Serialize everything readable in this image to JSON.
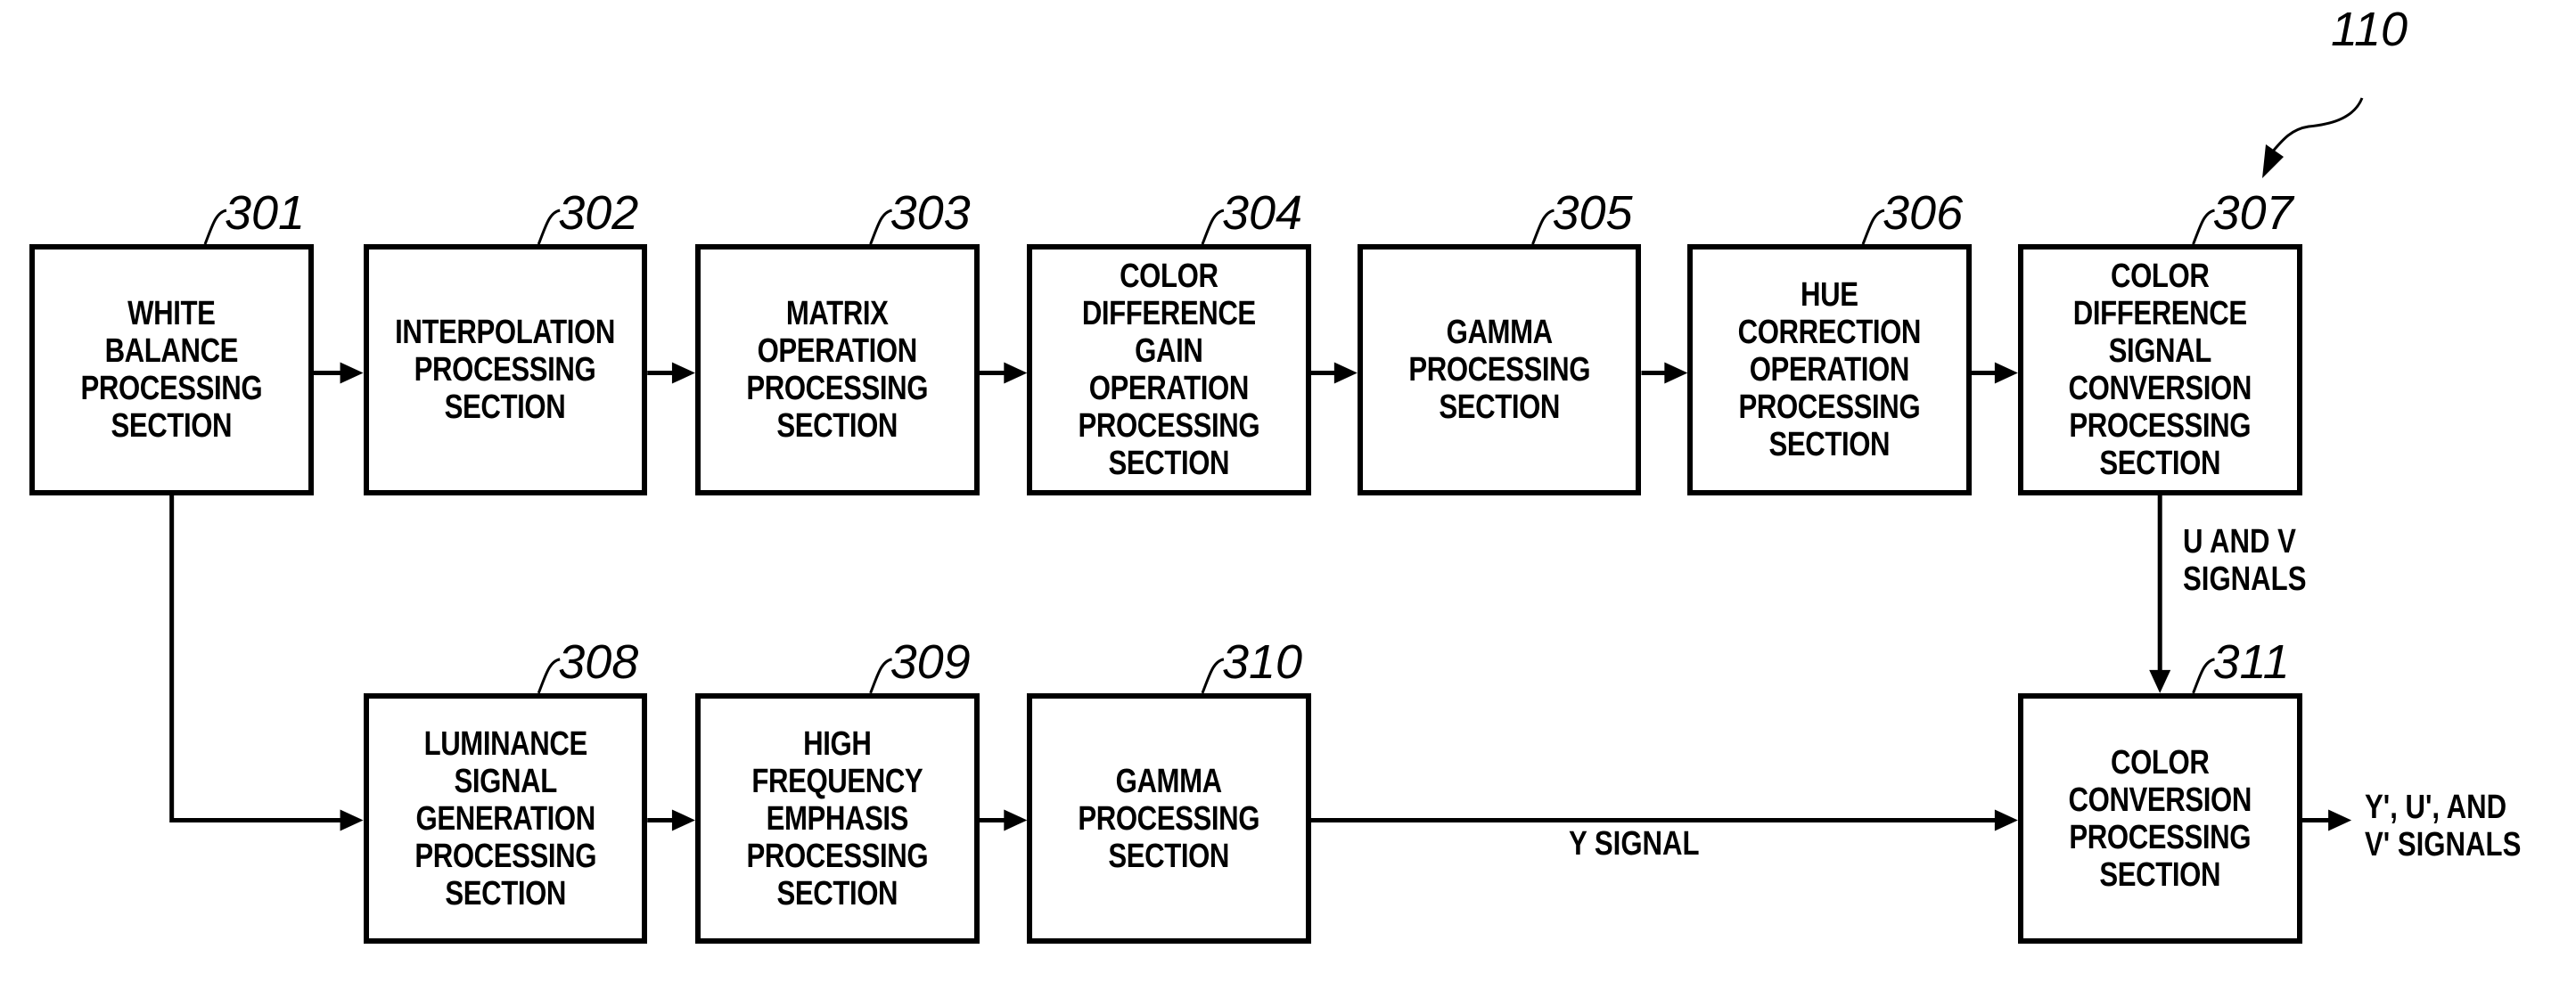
{
  "figure_ref": "110",
  "blocks": [
    {
      "id": "301",
      "label": "WHITE BALANCE\nPROCESSING\nSECTION"
    },
    {
      "id": "302",
      "label": "INTERPOLATION\nPROCESSING\nSECTION"
    },
    {
      "id": "303",
      "label": "MATRIX\nOPERATION\nPROCESSING\nSECTION"
    },
    {
      "id": "304",
      "label": "COLOR\nDIFFERENCE GAIN\nOPERATION\nPROCESSING\nSECTION"
    },
    {
      "id": "305",
      "label": "GAMMA\nPROCESSING\nSECTION"
    },
    {
      "id": "306",
      "label": "HUE CORRECTION\nOPERATION\nPROCESSING\nSECTION"
    },
    {
      "id": "307",
      "label": "COLOR\nDIFFERENCE\nSIGNAL\nCONVERSION\nPROCESSING\nSECTION"
    },
    {
      "id": "308",
      "label": "LUMINANCE\nSIGNAL\nGENERATION\nPROCESSING\nSECTION"
    },
    {
      "id": "309",
      "label": "HIGH FREQUENCY\nEMPHASIS\nPROCESSING\nSECTION"
    },
    {
      "id": "310",
      "label": "GAMMA\nPROCESSING\nSECTION"
    },
    {
      "id": "311",
      "label": "COLOR\nCONVERSION\nPROCESSING\nSECTION"
    }
  ],
  "signals": {
    "uv": "U AND V\nSIGNALS",
    "y": "Y SIGNAL",
    "output": "Y', U', AND\nV' SIGNALS"
  },
  "colors": {
    "line": "#000000",
    "background": "#ffffff"
  }
}
